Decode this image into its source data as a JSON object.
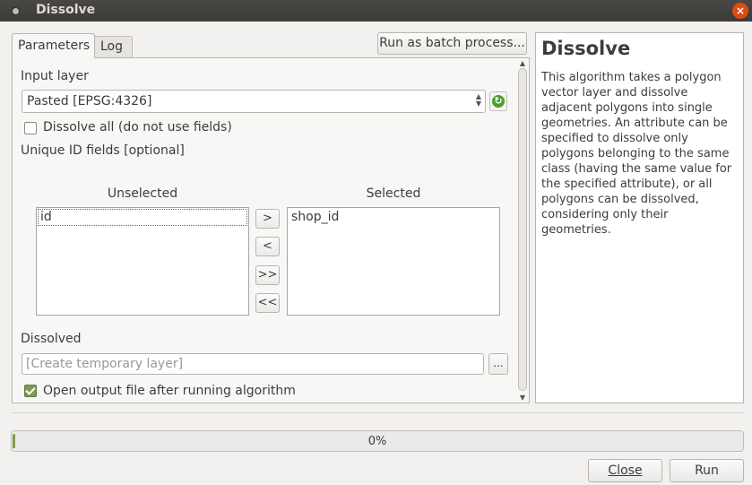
{
  "window": {
    "title": "Dissolve",
    "close_glyph": "×"
  },
  "tabs": [
    {
      "label": "Parameters",
      "active": true
    },
    {
      "label": "Log",
      "active": false
    }
  ],
  "batch_button_label": "Run as batch process...",
  "params": {
    "input_layer_label": "Input layer",
    "input_layer_value": "Pasted [EPSG:4326]",
    "dissolve_all_label": "Dissolve all (do not use fields)",
    "dissolve_all_checked": false,
    "unique_id_label": "Unique ID fields [optional]",
    "unselected_header": "Unselected",
    "selected_header": "Selected",
    "unselected_items": [
      "id"
    ],
    "selected_items": [
      "shop_id"
    ],
    "move_buttons": [
      ">",
      "<",
      ">>",
      "<<"
    ],
    "dissolved_label": "Dissolved",
    "dissolved_placeholder": "[Create temporary layer]",
    "browse_label": "...",
    "open_output_label": "Open output file after running algorithm",
    "open_output_checked": true
  },
  "help": {
    "title": "Dissolve",
    "text": "This algorithm takes a polygon vector layer and dissolve adjacent polygons into single geometries. An attribute can be specified to dissolve only polygons belonging to the same class (having the same value for the specified attribute), or all polygons can be dissolved, considering only their geometries."
  },
  "progress": {
    "value": 0,
    "text": "0%"
  },
  "footer": {
    "close_label": "Close",
    "run_label": "Run"
  },
  "colors": {
    "accent": "#7e9a52",
    "titlebar": "#3c3b37",
    "close": "#df4a16"
  }
}
